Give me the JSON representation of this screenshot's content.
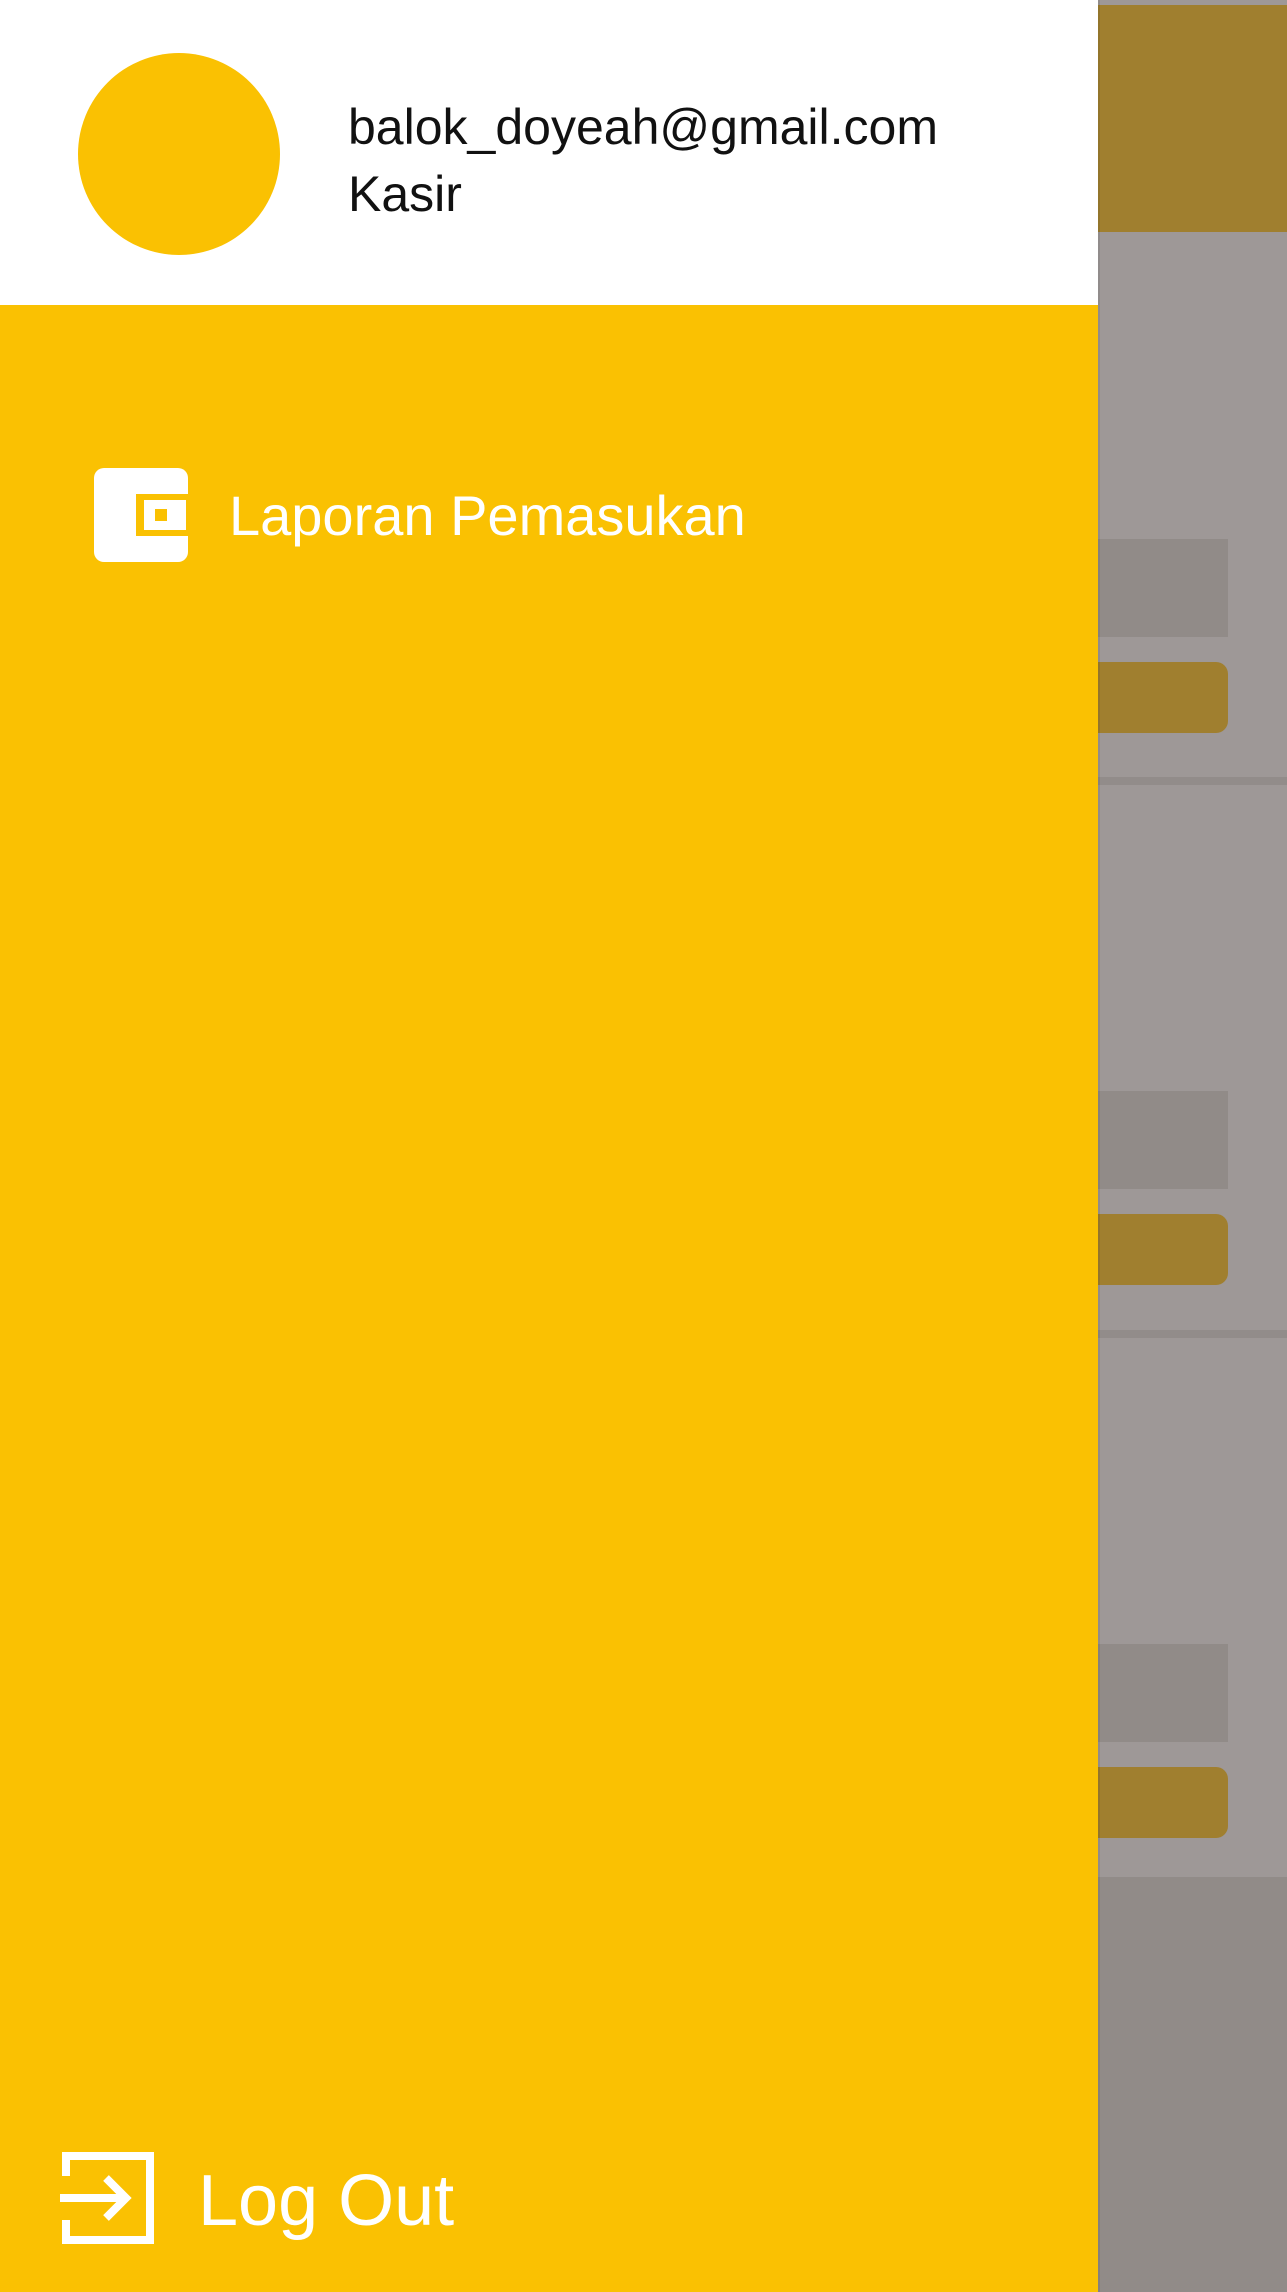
{
  "drawer": {
    "header": {
      "email": "balok_doyeah@gmail.com",
      "role": "Kasir"
    },
    "menu": [
      {
        "label": "Laporan Pemasukan",
        "icon": "wallet-icon"
      }
    ],
    "logout": {
      "label": "Log Out",
      "icon": "logout-icon"
    }
  },
  "colors": {
    "accent": "#fac102",
    "header_bg": "#ffffff",
    "scrim_appbar": "#a07f2f",
    "scrim_bg": "#9e9897"
  }
}
